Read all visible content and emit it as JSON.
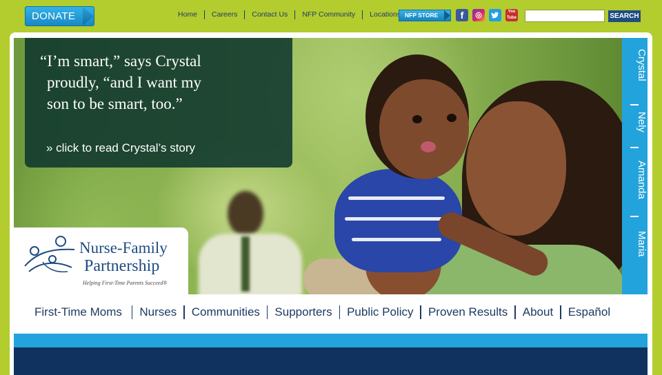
{
  "header": {
    "donate_label": "DONATE",
    "nav": [
      "Home",
      "Careers",
      "Contact Us",
      "NFP Community",
      "Locations"
    ],
    "store_label": "NFP STORE",
    "social": [
      {
        "name": "facebook-icon",
        "glyph": "f"
      },
      {
        "name": "instagram-icon",
        "glyph": "◎"
      },
      {
        "name": "twitter-icon",
        "glyph": "🐦"
      },
      {
        "name": "youtube-icon",
        "glyph": "You Tube"
      }
    ],
    "search": {
      "value": "",
      "placeholder": "",
      "button": "SEARCH"
    }
  },
  "hero": {
    "quote_line1": "“I’m smart,” says Crystal",
    "quote_line2": "proudly, “and I want my",
    "quote_line3": "son to be smart, too.”",
    "link": "» click to read Crystal’s story"
  },
  "logo": {
    "line1": "Nurse-Family",
    "line2": "Partnership",
    "tagline": "Helping First-Time Parents Succeed®"
  },
  "stories": [
    "Crystal",
    "Nely",
    "Amanda",
    "Maria"
  ],
  "main_nav": [
    "First-Time Moms",
    "Nurses",
    "Communities",
    "Supporters",
    "Public Policy",
    "Proven Results",
    "About",
    "Español"
  ],
  "colors": {
    "page_green": "#b3cc2e",
    "accent_blue": "#23a3dc",
    "navy": "#0f335e",
    "text_navy": "#1c3a63"
  }
}
